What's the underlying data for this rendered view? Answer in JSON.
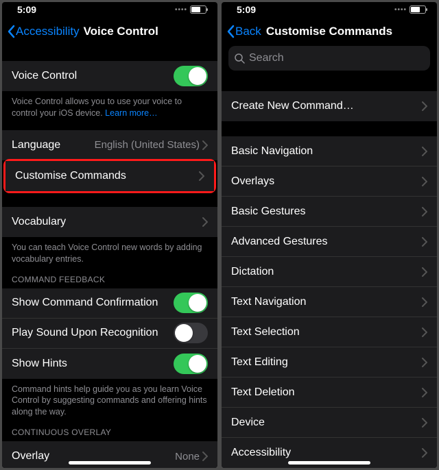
{
  "status": {
    "time": "5:09"
  },
  "left": {
    "back": "Accessibility",
    "title": "Voice Control",
    "voice_control_label": "Voice Control",
    "voice_control_desc": "Voice Control allows you to use your voice to control your iOS device. ",
    "learn_more": "Learn more…",
    "language_label": "Language",
    "language_value": "English (United States)",
    "customise_label": "Customise Commands",
    "vocabulary_label": "Vocabulary",
    "vocabulary_desc": "You can teach Voice Control new words by adding vocabulary entries.",
    "command_feedback_header": "COMMAND FEEDBACK",
    "show_confirm": "Show Command Confirmation",
    "play_sound": "Play Sound Upon Recognition",
    "show_hints": "Show Hints",
    "hints_desc": "Command hints help guide you as you learn Voice Control by suggesting commands and offering hints along the way.",
    "continuous_header": "CONTINUOUS OVERLAY",
    "overlay_label": "Overlay",
    "overlay_value": "None"
  },
  "right": {
    "back": "Back",
    "title": "Customise Commands",
    "search_placeholder": "Search",
    "create_new": "Create New Command…",
    "categories": [
      "Basic Navigation",
      "Overlays",
      "Basic Gestures",
      "Advanced Gestures",
      "Dictation",
      "Text Navigation",
      "Text Selection",
      "Text Editing",
      "Text Deletion",
      "Device",
      "Accessibility"
    ]
  }
}
